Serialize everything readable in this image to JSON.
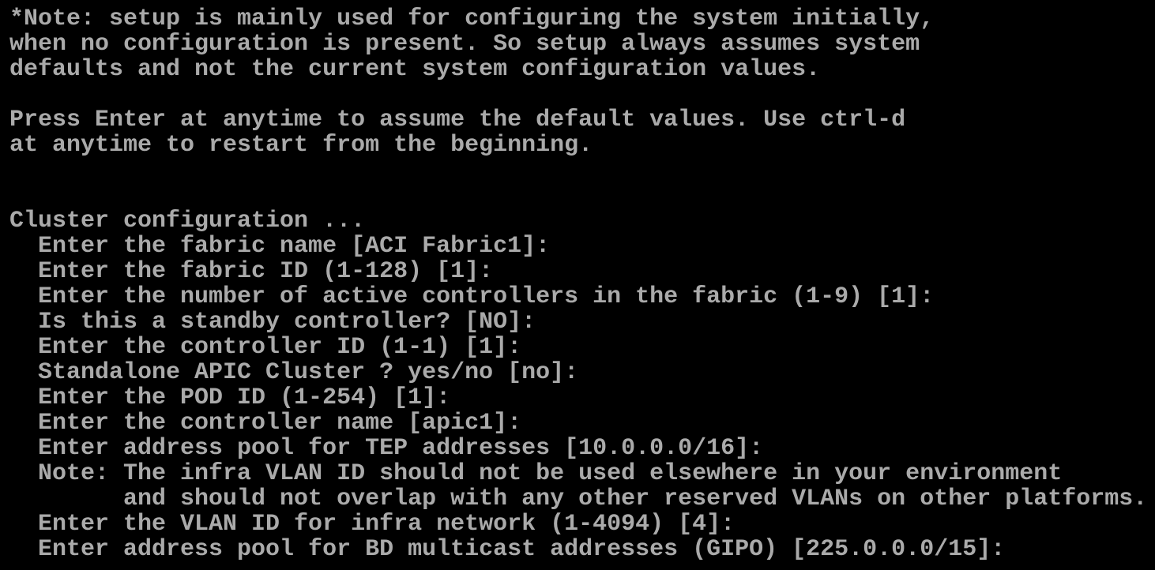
{
  "terminal": {
    "foreground": "#aaaaaa",
    "background": "#000000",
    "lines": [
      "*Note: setup is mainly used for configuring the system initially,",
      "when no configuration is present. So setup always assumes system",
      "defaults and not the current system configuration values.",
      "",
      "Press Enter at anytime to assume the default values. Use ctrl-d",
      "at anytime to restart from the beginning.",
      "",
      "",
      "Cluster configuration ...",
      "  Enter the fabric name [ACI Fabric1]:",
      "  Enter the fabric ID (1-128) [1]:",
      "  Enter the number of active controllers in the fabric (1-9) [1]:",
      "  Is this a standby controller? [NO]:",
      "  Enter the controller ID (1-1) [1]:",
      "  Standalone APIC Cluster ? yes/no [no]:",
      "  Enter the POD ID (1-254) [1]:",
      "  Enter the controller name [apic1]:",
      "  Enter address pool for TEP addresses [10.0.0.0/16]:",
      "  Note: The infra VLAN ID should not be used elsewhere in your environment",
      "        and should not overlap with any other reserved VLANs on other platforms.",
      "  Enter the VLAN ID for infra network (1-4094) [4]:",
      "  Enter address pool for BD multicast addresses (GIPO) [225.0.0.0/15]:"
    ]
  }
}
